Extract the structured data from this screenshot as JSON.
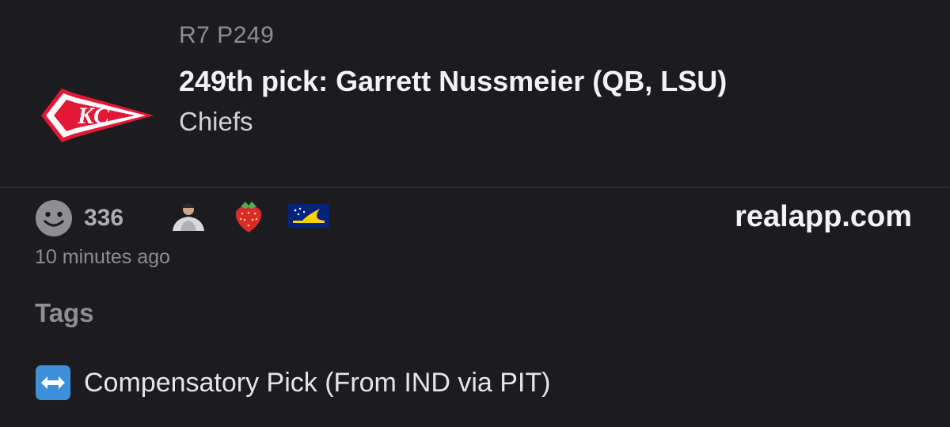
{
  "header": {
    "pick_code": "R7 P249",
    "title": "249th pick: Garrett Nussmeier (QB, LSU)",
    "team": "Chiefs",
    "logo_icon": "chiefs-arrowhead-logo",
    "logo_text": "KC"
  },
  "reactions": {
    "smiley_count": "336",
    "icons": [
      "smiley-face-icon",
      "person-avatar-icon",
      "strawberry-icon",
      "tokelau-flag-icon"
    ]
  },
  "source": {
    "label": "realapp.com"
  },
  "timestamp": "10 minutes ago",
  "tags": {
    "heading": "Tags",
    "items": [
      {
        "icon": "left-right-arrow-icon",
        "label": "Compensatory Pick (From IND via PIT)"
      }
    ]
  },
  "colors": {
    "background": "#1c1c1e",
    "chiefs_red": "#e31837",
    "arrow_blue": "#3d8fd9",
    "muted_text": "#8e8e93"
  }
}
